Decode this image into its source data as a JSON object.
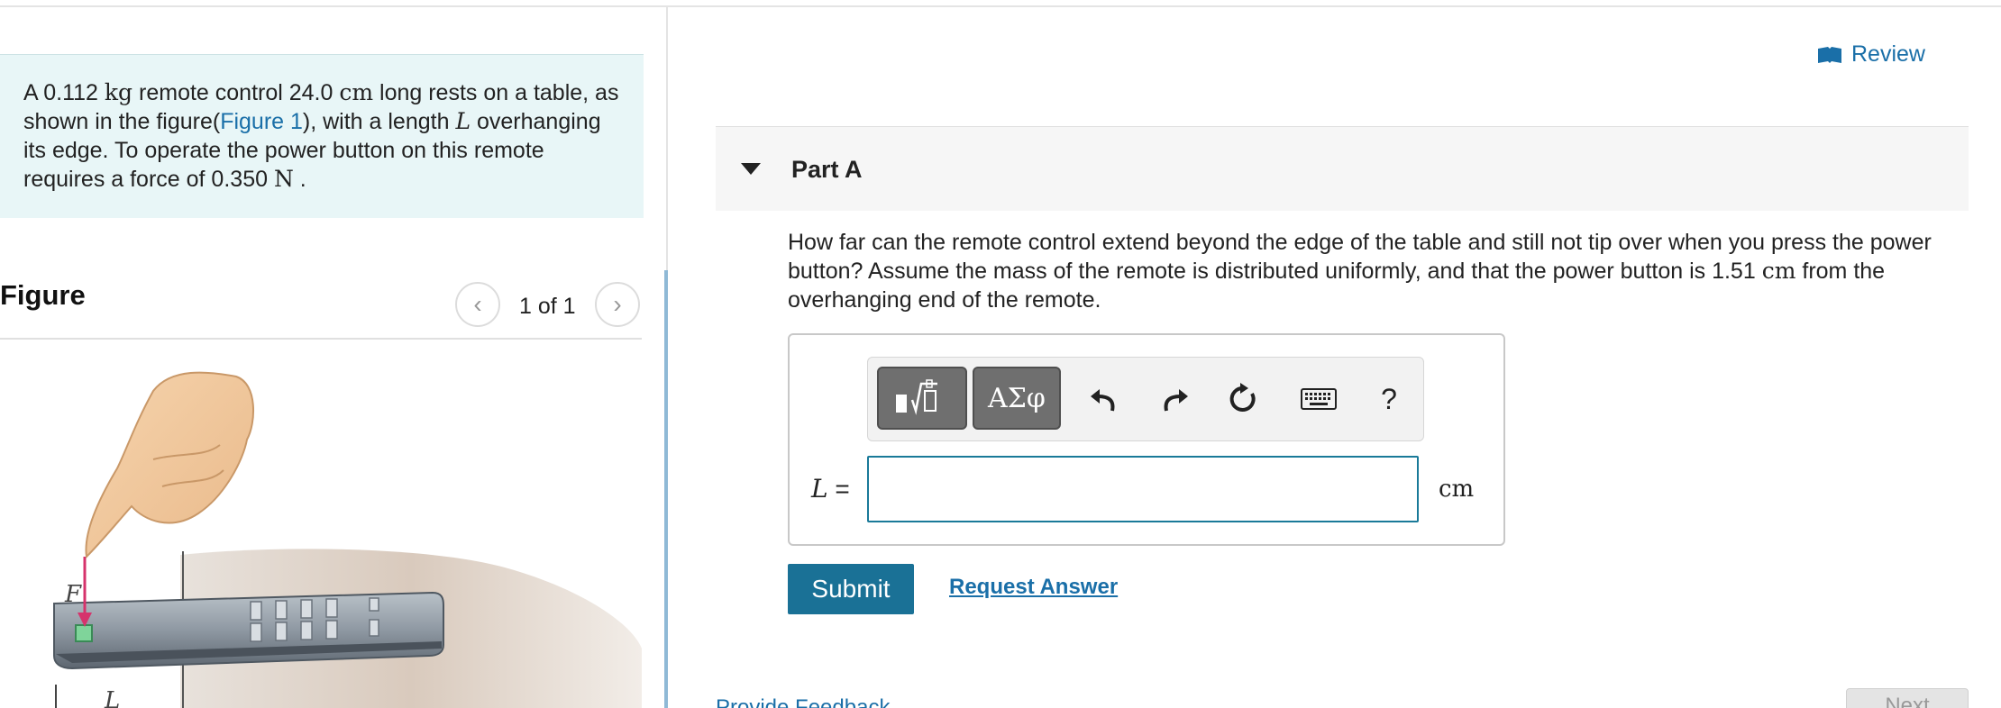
{
  "problem": {
    "text_1": "A 0.112 ",
    "mass_unit": "kg",
    "text_2": " remote control 24.0 ",
    "length_unit": "cm",
    "text_3": " long rests on a table, as shown in the figure(",
    "figure_link": "Figure 1",
    "text_4": "), with a length ",
    "length_var": "L",
    "text_5": " overhanging its edge. To operate the power button on this remote requires a force of 0.350 ",
    "force_unit": "N",
    "text_6": " ."
  },
  "figure": {
    "title": "Figure",
    "pager_text": "1 of 1",
    "prev_glyph": "‹",
    "next_glyph": "›",
    "force_label": "F",
    "length_label": "L"
  },
  "review": {
    "label": "Review",
    "icon": "book-icon"
  },
  "part": {
    "title": "Part A"
  },
  "question": {
    "text_1": "How far can the remote control extend beyond the edge of the table and still not tip over when you press the power button? Assume the mass of the remote is distributed uniformly, and that the power button is 1.51 ",
    "unit": "cm",
    "text_2": " from the overhanging end of the remote."
  },
  "toolbar": {
    "greek_label": "ΑΣφ",
    "help_label": "?",
    "icons": [
      "templates-icon",
      "greek-icon",
      "undo-icon",
      "redo-icon",
      "reset-icon",
      "keyboard-icon",
      "help-icon"
    ]
  },
  "answer": {
    "variable": "L",
    "equals": " =",
    "value": "",
    "unit": "cm"
  },
  "actions": {
    "submit_label": "Submit",
    "request_label": "Request Answer"
  },
  "footer": {
    "feedback_label": "Provide Feedback",
    "next_label": "Next"
  },
  "colors": {
    "link": "#1a6fa8",
    "submit_bg": "#1a7196",
    "problem_bg": "#e8f6f7",
    "input_border": "#1a7a99"
  }
}
